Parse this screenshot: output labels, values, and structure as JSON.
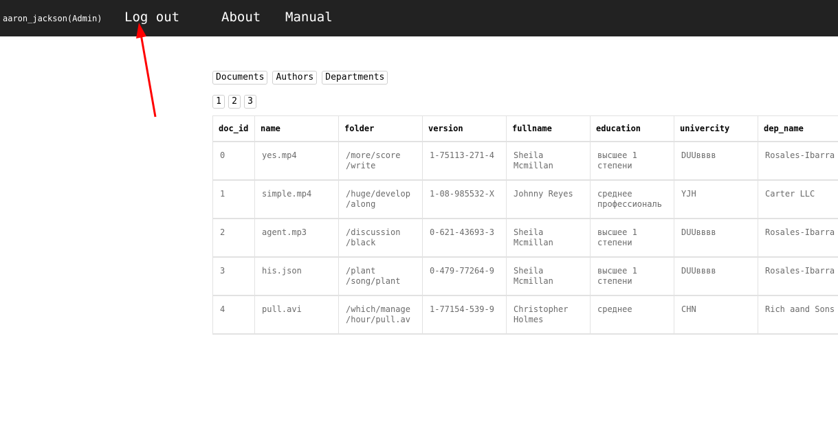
{
  "header": {
    "user_label": "aaron_jackson(Admin)",
    "logout_label": "Log out",
    "about_label": "About",
    "manual_label": "Manual"
  },
  "annotation": {
    "arrow_color": "#ff0000"
  },
  "tabs": [
    "Documents",
    "Authors",
    "Departments"
  ],
  "pages": [
    "1",
    "2",
    "3"
  ],
  "table": {
    "columns": [
      "doc_id",
      "name",
      "folder",
      "version",
      "fullname",
      "education",
      "univercity",
      "dep_name"
    ],
    "rows": [
      [
        "0",
        "yes.mp4",
        "/more/score /write",
        "1-75113-271-4",
        "Sheila Mcmillan",
        "высшее 1 степени",
        "DUUвввв",
        "Rosales-Ibarra"
      ],
      [
        "1",
        "simple.mp4",
        "/huge/develop /along",
        "1-08-985532-X",
        "Johnny Reyes",
        "среднее профессиональ",
        "YJH",
        "Carter LLC"
      ],
      [
        "2",
        "agent.mp3",
        "/discussion /black",
        "0-621-43693-3",
        "Sheila Mcmillan",
        "высшее 1 степени",
        "DUUвввв",
        "Rosales-Ibarra"
      ],
      [
        "3",
        "his.json",
        "/plant /song/plant",
        "0-479-77264-9",
        "Sheila Mcmillan",
        "высшее 1 степени",
        "DUUвввв",
        "Rosales-Ibarra"
      ],
      [
        "4",
        "pull.avi",
        "/which/manage /hour/pull.av",
        "1-77154-539-9",
        "Christopher Holmes",
        "среднее",
        "CHN",
        "Rich aand Sons"
      ]
    ]
  }
}
